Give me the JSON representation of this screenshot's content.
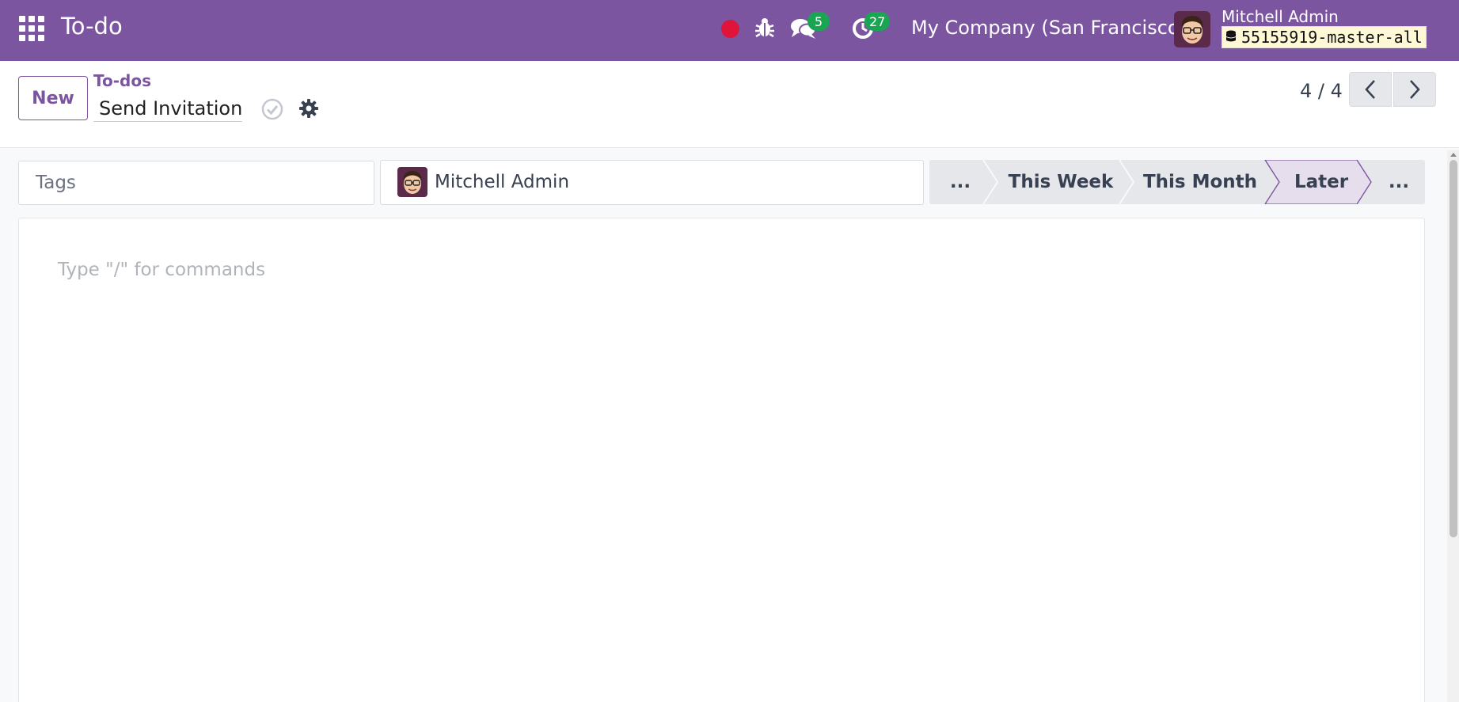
{
  "navbar": {
    "app_title": "To-do",
    "chat_badge": "5",
    "activity_badge": "27",
    "company": "My Company (San Francisco)",
    "user_name": "Mitchell Admin",
    "database": "55155919-master-all",
    "bg_color": "#7c55a0",
    "record_color": "#e0133a",
    "badge_color": "#1aa552"
  },
  "control_panel": {
    "new_label": "New",
    "breadcrumb": "To-dos",
    "record_name": "Send Invitation",
    "pager_value": "4 / 4"
  },
  "form": {
    "tags_placeholder": "Tags",
    "assignee": "Mitchell Admin",
    "stages": [
      {
        "label": "...",
        "active": false
      },
      {
        "label": "This Week",
        "active": false
      },
      {
        "label": "This Month",
        "active": false
      },
      {
        "label": "Later",
        "active": true
      },
      {
        "label": "...",
        "active": false
      }
    ],
    "editor_placeholder": "Type \"/\" for commands"
  }
}
